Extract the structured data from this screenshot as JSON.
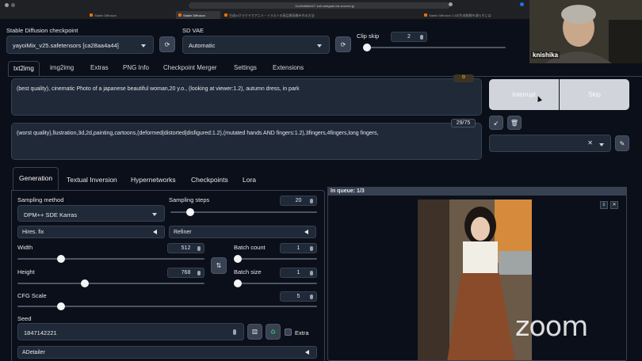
{
  "browser": {
    "tabs": [
      {
        "label": "Stable Diffusion",
        "active": false
      },
      {
        "label": "Stable Diffusion",
        "active": true
      },
      {
        "label": "生成AIクラウドでアニメ・イラストの高品質画像を作る方法",
        "active": false
      },
      {
        "label": "Stable Diffusion 1.5の生成枚数を減らすには",
        "active": false
      }
    ],
    "url": "11c0fe8bf8427 1a0.webgate-biz.ecomer.jp"
  },
  "header": {
    "checkpoint_label": "Stable Diffusion checkpoint",
    "checkpoint_value": "yayoiMix_v25.safetensors [ca28aa4a44]",
    "vae_label": "SD VAE",
    "vae_value": "Automatic",
    "clip_skip_label": "Clip skip",
    "clip_skip_value": "2"
  },
  "main_tabs": [
    "txt2img",
    "img2img",
    "Extras",
    "PNG Info",
    "Checkpoint Merger",
    "Settings",
    "Extensions"
  ],
  "prompts": {
    "positive": "(best quality), cinematic Photo of a japanese beautiful woman,20 y.o., (looking at viewer:1.2), autumn dress, in park",
    "negative": "(worst quality),llustration,3d,2d,painting,cartoons,(deformed|distorted|disfigured:1.2),(mutated hands AND fingers:1.2),3fingers,4fingers,long fingers,",
    "token_count": "29/75"
  },
  "actions": {
    "interrupt": "Interrupt",
    "skip": "Skip"
  },
  "sub_tabs": [
    "Generation",
    "Textual Inversion",
    "Hypernetworks",
    "Checkpoints",
    "Lora"
  ],
  "generation": {
    "sampling_method_label": "Sampling method",
    "sampling_method_value": "DPM++ SDE Karras",
    "sampling_steps_label": "Sampling steps",
    "sampling_steps_value": "20",
    "hires_fix": "Hires. fix",
    "refiner": "Refiner",
    "width_label": "Width",
    "width_value": "512",
    "height_label": "Height",
    "height_value": "768",
    "batch_count_label": "Batch count",
    "batch_count_value": "1",
    "batch_size_label": "Batch size",
    "batch_size_value": "1",
    "cfg_label": "CFG Scale",
    "cfg_value": "5",
    "seed_label": "Seed",
    "seed_value": "1847142221",
    "extra_label": "Extra",
    "adetailer": "ADetailer"
  },
  "output": {
    "queue_text": "In queue: 1/3"
  },
  "video_call": {
    "participant_name": "knishika",
    "watermark": "zoom"
  },
  "colors": {
    "background": "#0b0f19",
    "panel": "#1f2937",
    "border": "#374151",
    "button": "#d1d5db"
  }
}
